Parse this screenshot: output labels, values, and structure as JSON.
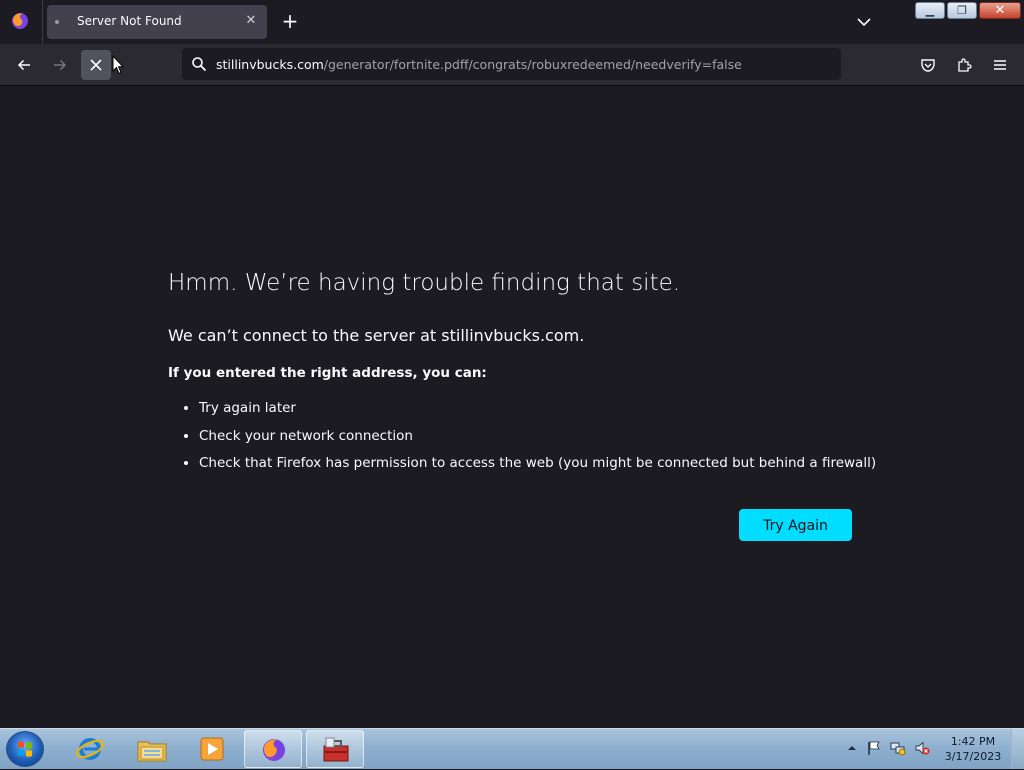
{
  "browser": {
    "tab": {
      "title": "Server Not Found"
    },
    "url": {
      "host": "stillinvbucks.com",
      "path": "/generator/fortnite.pdff/congrats/robuxredeemed/needverify=false"
    },
    "icons": [
      "firefox-icon",
      "tab-close-icon",
      "new-tab-icon",
      "tab-list-icon",
      "back-icon",
      "forward-icon",
      "stop-icon",
      "search-icon",
      "pocket-icon",
      "extensions-icon",
      "menu-icon"
    ]
  },
  "error": {
    "title": "Hmm. We’re having trouble finding that site.",
    "description": "We can’t connect to the server at stillinvbucks.com.",
    "subtitle": "If you entered the right address, you can:",
    "suggestions": [
      "Try again later",
      "Check your network connection",
      "Check that Firefox has permission to access the web (you might be connected but behind a firewall)"
    ],
    "button_label": "Try Again"
  },
  "taskbar": {
    "apps": [
      "internet-explorer-icon",
      "file-explorer-icon",
      "media-player-icon",
      "firefox-icon",
      "toolbox-icon"
    ],
    "clock": {
      "time": "1:42 PM",
      "date": "3/17/2023"
    }
  },
  "colors": {
    "page_bg": "#1c1b22",
    "toolbar_bg": "#2b2a33",
    "accent": "#00ddff"
  }
}
